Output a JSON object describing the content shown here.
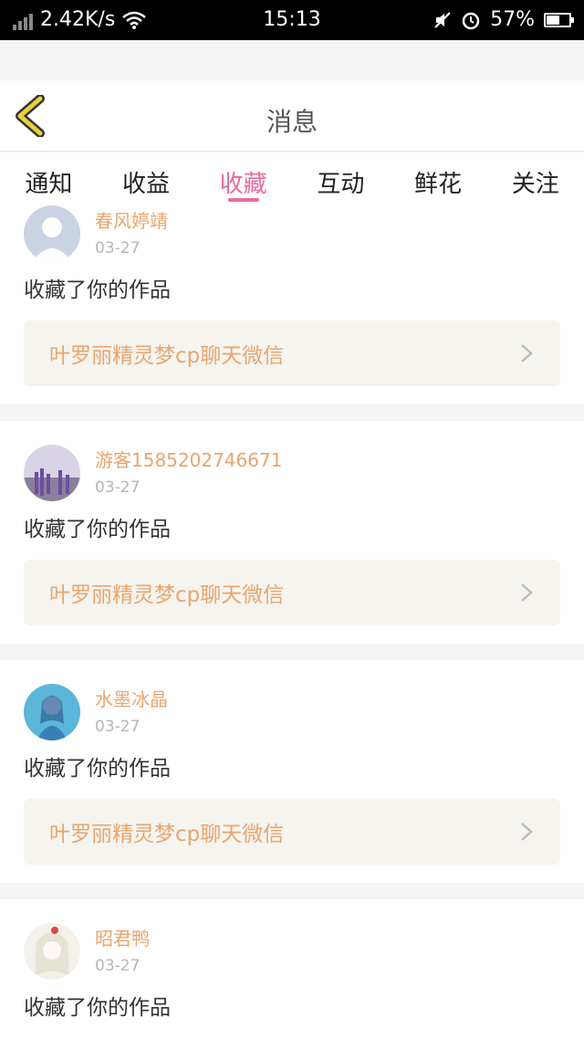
{
  "status_bar": {
    "speed": "2.42K/s",
    "time": "15:13",
    "battery": "57%",
    "battery_level": 0.57
  },
  "header": {
    "title": "消息"
  },
  "tabs": [
    {
      "label": "通知",
      "active": false
    },
    {
      "label": "收益",
      "active": false
    },
    {
      "label": "收藏",
      "active": true
    },
    {
      "label": "互动",
      "active": false
    },
    {
      "label": "鲜花",
      "active": false
    },
    {
      "label": "关注",
      "active": false
    }
  ],
  "feed": [
    {
      "user": "春风婷靖",
      "date": "03-27",
      "action": "收藏了你的作品",
      "work": "叶罗丽精灵梦cp聊天微信"
    },
    {
      "user": "游客1585202746671",
      "date": "03-27",
      "action": "收藏了你的作品",
      "work": "叶罗丽精灵梦cp聊天微信"
    },
    {
      "user": "水墨冰晶",
      "date": "03-27",
      "action": "收藏了你的作品",
      "work": "叶罗丽精灵梦cp聊天微信"
    },
    {
      "user": "昭君鸭",
      "date": "03-27",
      "action": "收藏了你的作品"
    }
  ],
  "colors": {
    "accent": "#e86aa0",
    "name": "#e9a56e",
    "back_icon": "#e8d13a"
  }
}
